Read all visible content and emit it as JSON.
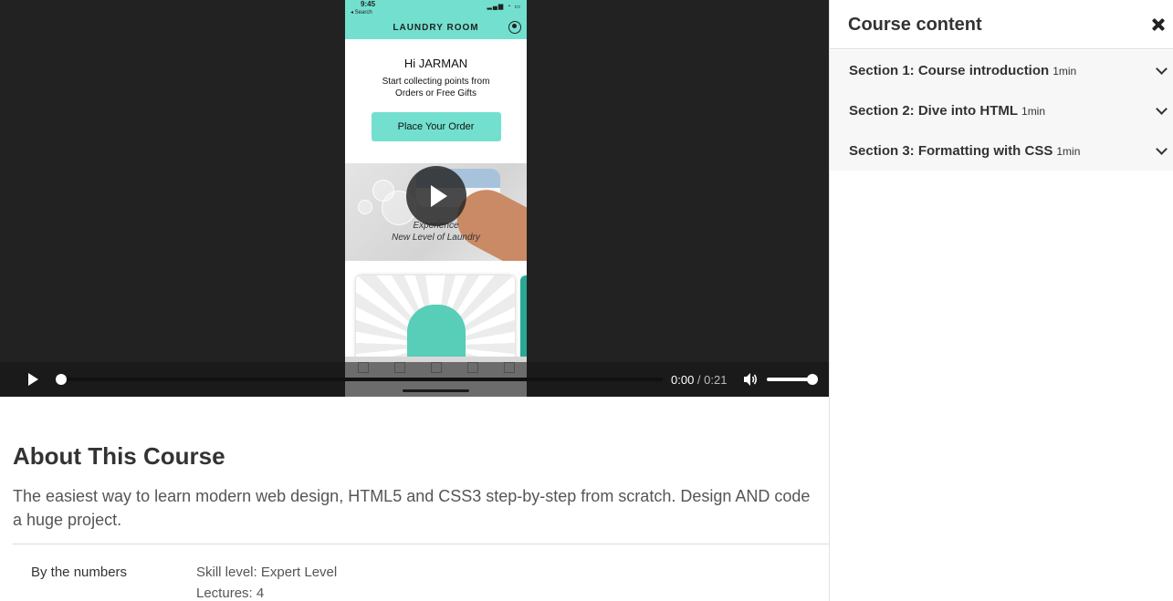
{
  "video": {
    "time_current": "0:00",
    "time_separator": " / ",
    "time_total": "0:21",
    "progress": 0,
    "volume": 1.0
  },
  "phone": {
    "status_time": "9:45",
    "status_back": "◂ Search",
    "brand": "LAUNDRY ROOM",
    "greeting": "Hi JARMAN",
    "subtitle_line1": "Start collecting points from",
    "subtitle_line2": "Orders or Free Gifts",
    "order_button": "Place Your Order",
    "banner_line1": "Experience",
    "banner_line2": "New Level of Laundry"
  },
  "about": {
    "title": "About This Course",
    "description": "The easiest way to learn modern web design, HTML5 and CSS3 step-by-step from scratch. Design AND code a huge project.",
    "numbers_label": "By the numbers",
    "skill_level": "Skill level: Expert Level",
    "lectures": "Lectures: 4"
  },
  "panel": {
    "title": "Course content",
    "sections": [
      {
        "title": "Section 1: Course introduction",
        "duration": "1min"
      },
      {
        "title": "Section 2: Dive into HTML",
        "duration": "1min"
      },
      {
        "title": "Section 3: Formatting with CSS",
        "duration": "1min"
      }
    ]
  }
}
